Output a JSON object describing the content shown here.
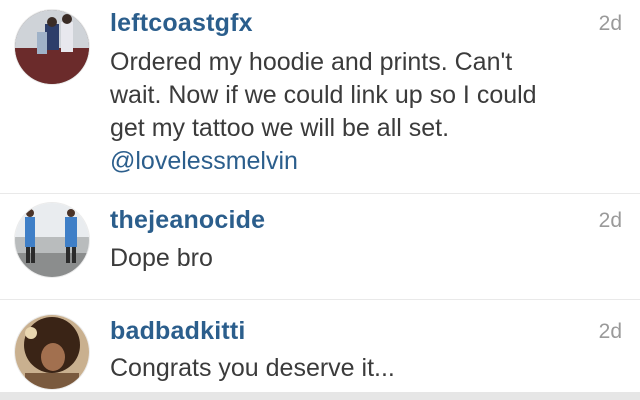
{
  "comments": [
    {
      "username": "leftcoastgfx",
      "time": "2d",
      "lines": [
        "Ordered my hoodie and prints. Can't",
        "wait. Now if we could link up so I could",
        "get my tattoo we will be all set."
      ],
      "mention": "@lovelessmelvin"
    },
    {
      "username": "thejeanocide",
      "time": "2d",
      "text": "Dope bro"
    },
    {
      "username": "badbadkitti",
      "time": "2d",
      "text": "Congrats you deserve it..."
    }
  ],
  "colors": {
    "username": "#2b5e8c",
    "mention": "#2b5e8c",
    "body_text": "#3b3b3b",
    "timestamp": "#9a9a9a",
    "divider": "#e9e9e9"
  }
}
